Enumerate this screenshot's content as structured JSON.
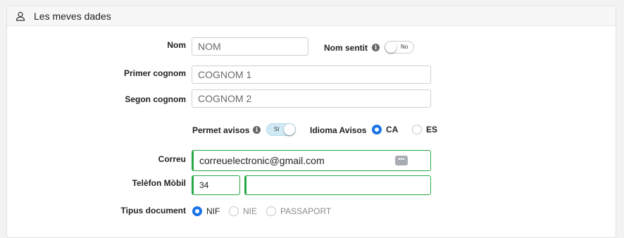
{
  "header": {
    "title": "Les meves dades",
    "icon": "user-icon"
  },
  "form": {
    "nom": {
      "label": "Nom",
      "placeholder": "NOM"
    },
    "nom_sentit": {
      "label": "Nom sentit",
      "toggle_text": "No",
      "checked": false
    },
    "primer_cognom": {
      "label": "Primer cognom",
      "placeholder": "COGNOM 1"
    },
    "segon_cognom": {
      "label": "Segon cognom",
      "placeholder": "COGNOM 2"
    },
    "permet_avisos": {
      "label": "Permet avisos",
      "toggle_text": "Sí",
      "checked": true
    },
    "idioma_avisos": {
      "label": "Idioma Avisos",
      "options": [
        "CA",
        "ES"
      ],
      "selected": "CA"
    },
    "correu": {
      "label": "Correu",
      "value": "correuelectronic@gmail.com"
    },
    "telefon": {
      "label": "Telèfon Mòbil",
      "prefix": "34",
      "number": ""
    },
    "tipus_document": {
      "label": "Tipus document",
      "options": [
        "NIF",
        "NIE",
        "PASSAPORT"
      ],
      "selected": "NIF"
    }
  },
  "colors": {
    "accent": "#1a73e8",
    "valid": "#2aa746"
  }
}
